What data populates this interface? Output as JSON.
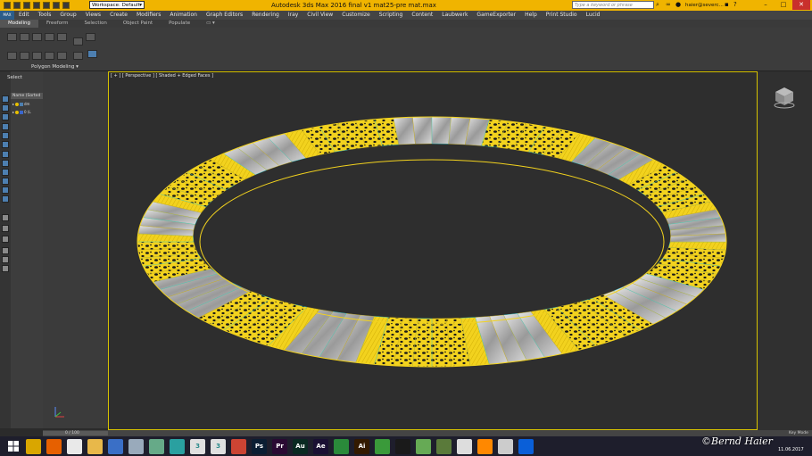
{
  "titlebar": {
    "workspace": "Workspace: Default",
    "title": "Autodesk 3ds Max 2016      final v1 mat25-pre mat.max",
    "search_placeholder": "Type a keyword or phrase",
    "user": "haier@severc..."
  },
  "menus": [
    "Edit",
    "Tools",
    "Group",
    "Views",
    "Create",
    "Modifiers",
    "Animation",
    "Graph Editors",
    "Rendering",
    "Iray",
    "Civil View",
    "Customize",
    "Scripting",
    "Content",
    "Laubwerk",
    "GameExporter",
    "Help",
    "Print Studio",
    "Lucid"
  ],
  "menu_logo": "MAX",
  "ribbon": {
    "tabs": [
      "Modeling",
      "Freeform",
      "Selection",
      "Object Paint",
      "Populate"
    ],
    "panel_label": "Polygon Modeling"
  },
  "explorer": {
    "select_label": "Select",
    "name_header": "Name (Sorted",
    "rows": [
      "dm",
      "0 (L"
    ]
  },
  "viewport": {
    "label": "[ + ] [ Perspective ] [ Shaded + Edged Faces ]"
  },
  "timeline": {
    "frame_label": "0 / 100",
    "status": "Key Mode"
  },
  "taskbar": {
    "icons": [
      "windows-start",
      "explorer",
      "firefox",
      "chrome",
      "folder",
      "floppy",
      "alien",
      "media",
      "3dsmax",
      "3dsmax-2",
      "3dsmax-3",
      "sketchup",
      "photoshop",
      "premiere",
      "audition",
      "after-effects",
      "refresh",
      "illustrator",
      "globe",
      "arrow-up",
      "photo",
      "game",
      "window",
      "vlc",
      "screen",
      "teamviewer"
    ],
    "watermark": "©Bernd Haier",
    "date": "11.06.2017"
  },
  "colors": {
    "titlebar": "#f0b400",
    "wire_yellow": "#f2d21e",
    "shell_gray": "#bdbdbd",
    "viewport_border": "#d6c200"
  }
}
